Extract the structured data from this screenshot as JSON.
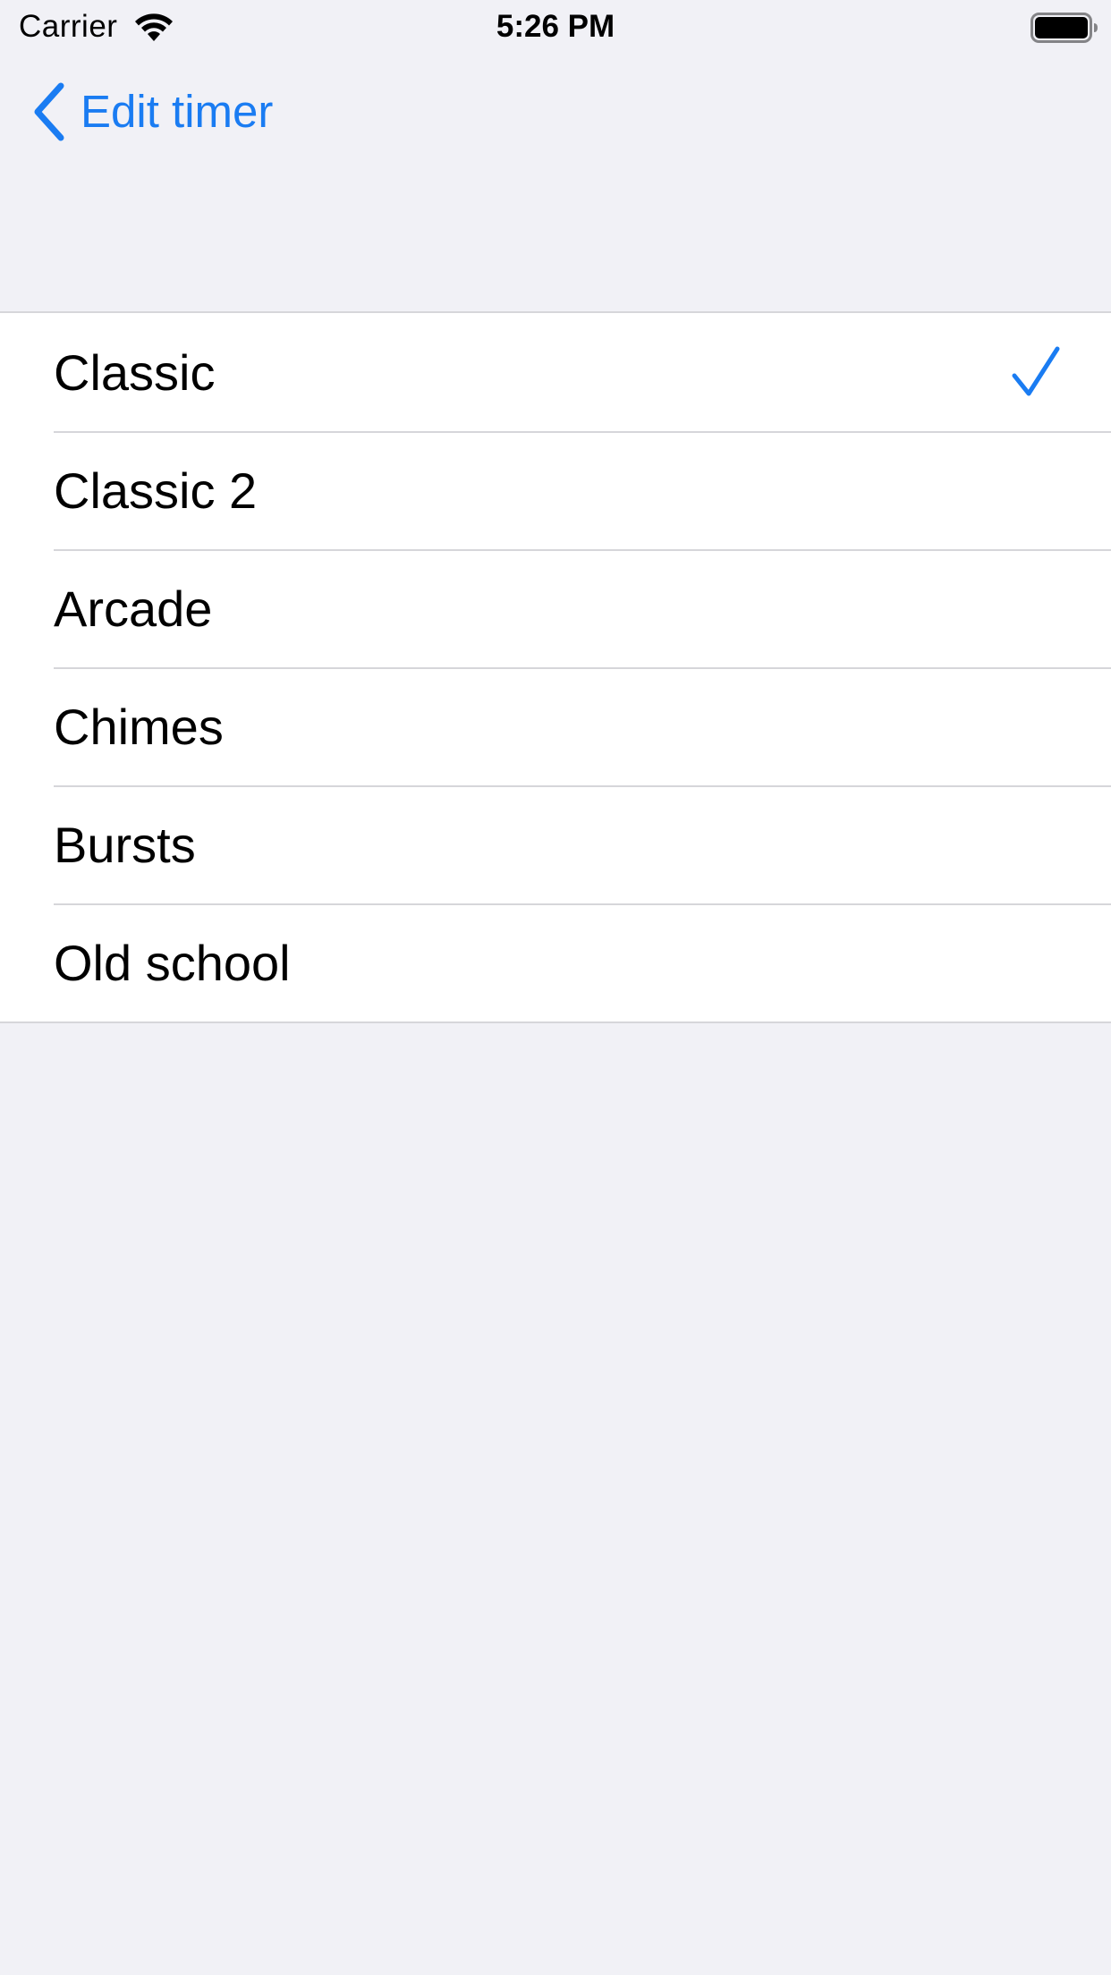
{
  "status_bar": {
    "carrier": "Carrier",
    "time": "5:26 PM",
    "wifi_icon": "wifi-icon",
    "battery_icon": "battery-full-icon"
  },
  "nav": {
    "back_label": "Edit timer",
    "back_icon": "chevron-left-icon"
  },
  "sounds": {
    "items": [
      {
        "label": "Classic",
        "selected": true
      },
      {
        "label": "Classic 2",
        "selected": false
      },
      {
        "label": "Arcade",
        "selected": false
      },
      {
        "label": "Chimes",
        "selected": false
      },
      {
        "label": "Bursts",
        "selected": false
      },
      {
        "label": "Old school",
        "selected": false
      }
    ],
    "check_icon": "checkmark-icon"
  },
  "colors": {
    "accent": "#1a7cf2",
    "background": "#f1f1f6",
    "cell": "#ffffff",
    "separator": "#d6d6da"
  }
}
